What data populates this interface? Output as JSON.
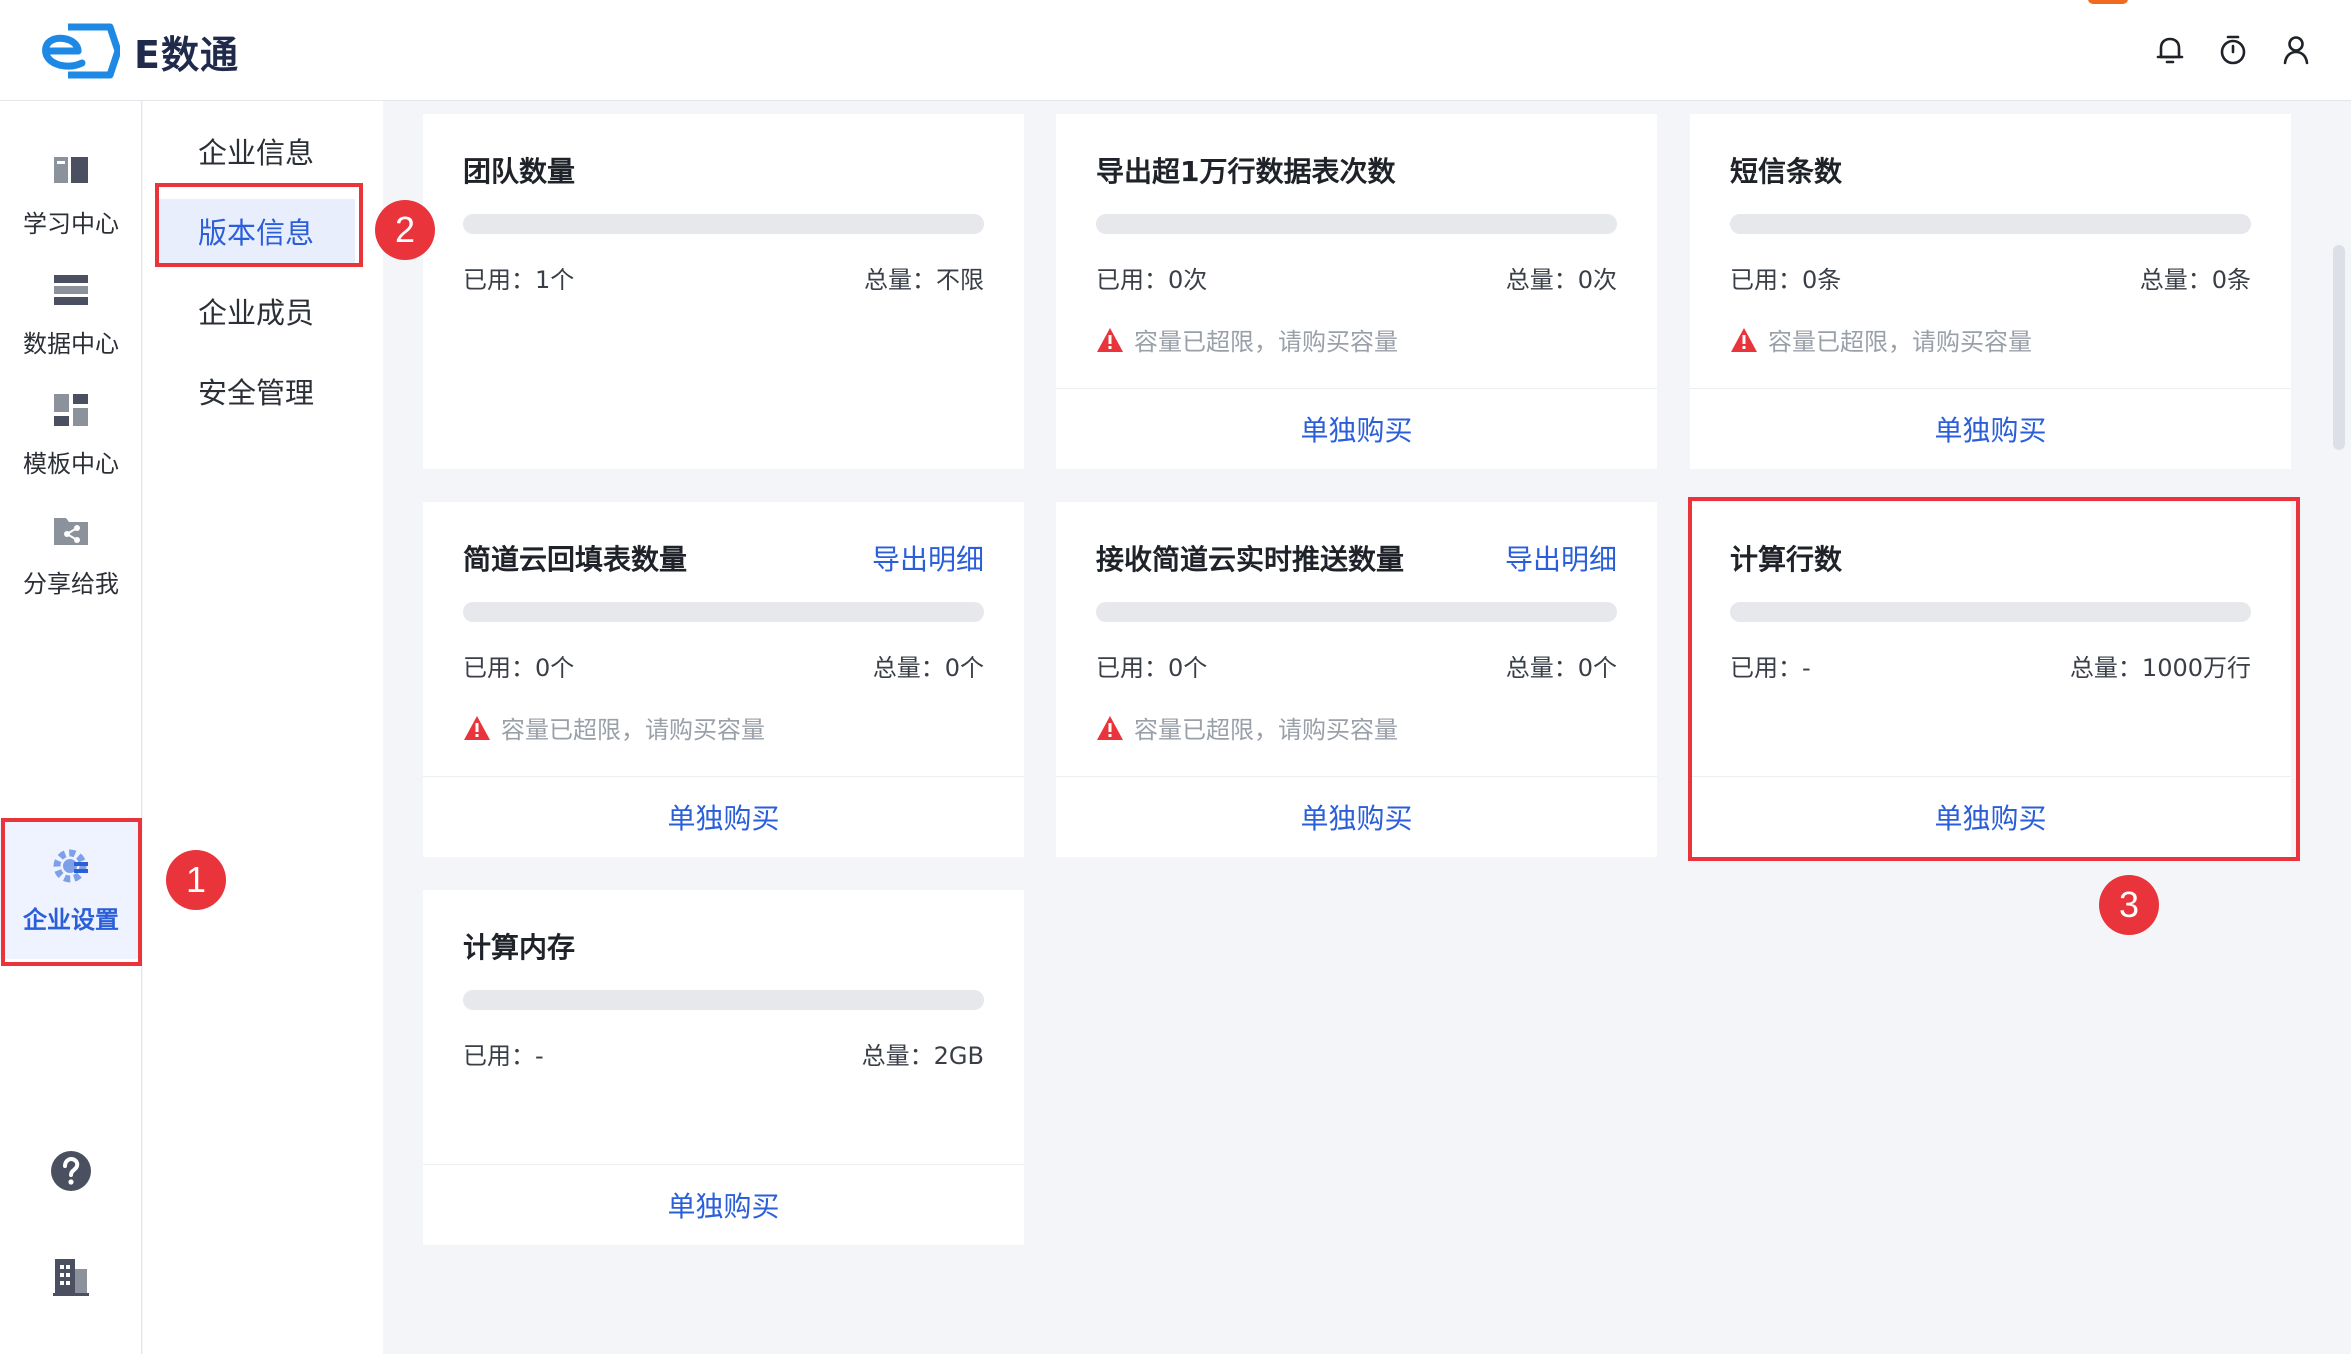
{
  "app": {
    "title": "E数通",
    "colors": {
      "accent": "#2b5fd9",
      "annotation": "#e8343a",
      "warning": "#e8343a",
      "brand_logo": "#1e88e5"
    }
  },
  "header": {
    "icons": [
      "bell-icon",
      "timer-icon",
      "user-icon"
    ]
  },
  "rail": {
    "items": [
      {
        "label": "学习中心",
        "icon": "book-icon"
      },
      {
        "label": "数据中心",
        "icon": "database-icon"
      },
      {
        "label": "模板中心",
        "icon": "template-icon"
      },
      {
        "label": "分享给我",
        "icon": "share-icon"
      },
      {
        "label": "企业设置",
        "icon": "gear-icon",
        "active": true
      }
    ],
    "bottom_icons": [
      "help-icon",
      "building-icon"
    ]
  },
  "submenu": {
    "items": [
      {
        "label": "企业信息"
      },
      {
        "label": "版本信息",
        "active": true
      },
      {
        "label": "企业成员"
      },
      {
        "label": "安全管理"
      }
    ]
  },
  "cards": [
    {
      "title": "团队数量",
      "export": "",
      "used": "已用：1个",
      "total": "总量：不限",
      "warning": "",
      "footer": ""
    },
    {
      "title": "导出超1万行数据表次数",
      "export": "",
      "used": "已用：0次",
      "total": "总量：0次",
      "warning": "容量已超限，请购买容量",
      "footer": "单独购买"
    },
    {
      "title": "短信条数",
      "export": "",
      "used": "已用：0条",
      "total": "总量：0条",
      "warning": "容量已超限，请购买容量",
      "footer": "单独购买"
    },
    {
      "title": "简道云回填表数量",
      "export": "导出明细",
      "used": "已用：0个",
      "total": "总量：0个",
      "warning": "容量已超限，请购买容量",
      "footer": "单独购买"
    },
    {
      "title": "接收简道云实时推送数量",
      "export": "导出明细",
      "used": "已用：0个",
      "total": "总量：0个",
      "warning": "容量已超限，请购买容量",
      "footer": "单独购买"
    },
    {
      "title": "计算行数",
      "export": "",
      "used": "已用：-",
      "total": "总量：1000万行",
      "warning": "",
      "footer": "单独购买"
    },
    {
      "title": "计算内存",
      "export": "",
      "used": "已用：-",
      "total": "总量：2GB",
      "warning": "",
      "footer": "单独购买"
    }
  ],
  "annotations": {
    "badge_1": "1",
    "badge_2": "2",
    "badge_3": "3"
  }
}
